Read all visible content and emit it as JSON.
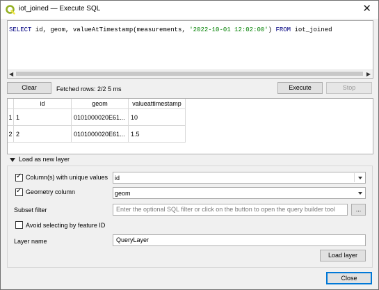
{
  "window": {
    "title": "iot_joined — Execute SQL",
    "close_icon": "close-icon",
    "app_icon": "qgis-icon"
  },
  "editor": {
    "sql_keyword_select": "SELECT",
    "sql_mid": " id, geom, valueAtTimestamp(measurements, ",
    "sql_string": "'2022-10-01 12:02:00'",
    "sql_paren": ") ",
    "sql_keyword_from": "FROM",
    "sql_table": " iot_joined"
  },
  "toolbar": {
    "clear_label": "Clear",
    "fetched_rows": "Fetched rows: 2/2  5 ms",
    "execute_label": "Execute",
    "stop_label": "Stop"
  },
  "results": {
    "columns": [
      "id",
      "geom",
      "valueattimestamp"
    ],
    "rows": [
      {
        "row_header": "1",
        "cells": [
          "1",
          "0101000020E61...",
          "10"
        ]
      },
      {
        "row_header": "2",
        "cells": [
          "2",
          "0101000020E61...",
          "1.5"
        ]
      }
    ]
  },
  "load_layer": {
    "toggle_label": "Load as new layer",
    "unique_values_label": "Column(s) with unique values",
    "unique_values_checked": true,
    "unique_values_value": "id",
    "geometry_label": "Geometry column",
    "geometry_checked": true,
    "geometry_value": "geom",
    "subset_label": "Subset filter",
    "subset_placeholder": "Enter the optional SQL filter or click on the button to open the query builder tool",
    "subset_button": "...",
    "avoid_label": "Avoid selecting by feature ID",
    "avoid_checked": false,
    "layer_name_label": "Layer name",
    "layer_name_value": "QueryLayer",
    "load_button": "Load layer"
  },
  "footer": {
    "close_label": "Close"
  },
  "colors": {
    "accent": "#0078d7",
    "sql_keyword": "#000080",
    "sql_string": "#008000",
    "qgis_green": "#93b023"
  }
}
